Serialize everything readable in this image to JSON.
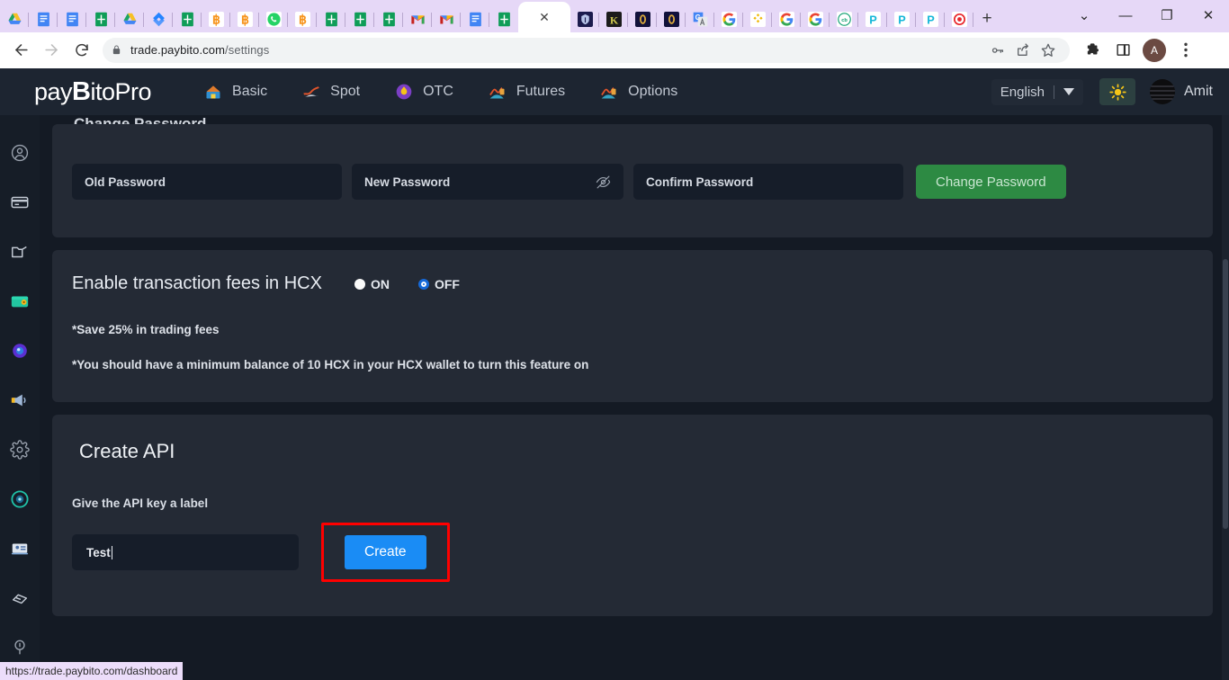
{
  "browser": {
    "tabs": [
      {
        "icon": "google-drive-icon",
        "type": "drive",
        "active": false
      },
      {
        "icon": "google-docs-icon",
        "type": "docs",
        "active": false
      },
      {
        "icon": "google-docs-icon",
        "type": "docs",
        "active": false
      },
      {
        "icon": "google-sheets-icon",
        "type": "sheets",
        "active": false
      },
      {
        "icon": "google-drive-icon",
        "type": "drive",
        "active": false
      },
      {
        "icon": "jira-icon",
        "type": "jira",
        "active": false
      },
      {
        "icon": "google-sheets-icon",
        "type": "sheets",
        "active": false
      },
      {
        "icon": "bitcoin-icon",
        "type": "btc",
        "active": false
      },
      {
        "icon": "bitcoin-icon",
        "type": "btc",
        "active": false
      },
      {
        "icon": "whatsapp-icon",
        "type": "whatsapp",
        "active": false
      },
      {
        "icon": "bitcoin-icon",
        "type": "btc",
        "active": false
      },
      {
        "icon": "google-sheets-icon",
        "type": "sheets",
        "active": false
      },
      {
        "icon": "google-sheets-icon",
        "type": "sheets",
        "active": false
      },
      {
        "icon": "google-sheets-icon",
        "type": "sheets",
        "active": false
      },
      {
        "icon": "gmail-icon",
        "type": "gmail",
        "active": false
      },
      {
        "icon": "gmail-icon",
        "type": "gmail",
        "active": false
      },
      {
        "icon": "google-docs-icon",
        "type": "docs",
        "active": false
      },
      {
        "icon": "google-sheets-icon",
        "type": "sheets",
        "active": false
      },
      {
        "icon": "close-icon",
        "type": "active",
        "active": true
      },
      {
        "icon": "paybito-icon",
        "type": "paybito",
        "active": false
      },
      {
        "icon": "kraken-icon",
        "type": "kraken",
        "active": false
      },
      {
        "icon": "coin-icon",
        "type": "coin",
        "active": false
      },
      {
        "icon": "coin-icon",
        "type": "coin",
        "active": false
      },
      {
        "icon": "google-translate-icon",
        "type": "translate",
        "active": false
      },
      {
        "icon": "google-icon",
        "type": "google",
        "active": false
      },
      {
        "icon": "binance-icon",
        "type": "binance",
        "active": false
      },
      {
        "icon": "google-icon",
        "type": "google",
        "active": false
      },
      {
        "icon": "google-icon",
        "type": "google",
        "active": false
      },
      {
        "icon": "coinbase-icon",
        "type": "coinbase",
        "active": false
      },
      {
        "icon": "paybito-p-icon",
        "type": "pbp",
        "active": false
      },
      {
        "icon": "paybito-p-icon",
        "type": "pbp",
        "active": false
      },
      {
        "icon": "paybito-p-icon",
        "type": "pbp",
        "active": false
      },
      {
        "icon": "record-icon",
        "type": "record",
        "active": false
      }
    ],
    "new_tab_label": "+",
    "tab_close_label": "✕",
    "window_controls": {
      "tab_search": "⌄",
      "minimize": "—",
      "maximize": "❐",
      "close": "✕"
    },
    "toolbar": {
      "back": "back-arrow",
      "forward": "forward-arrow",
      "reload": "reload-icon",
      "lock": "lock-icon",
      "url_domain": "trade.paybito.com",
      "url_path": "/settings",
      "password_key": "key-icon",
      "share": "share-icon",
      "bookmark": "star-icon",
      "extensions": "puzzle-icon",
      "sidepanel": "side-panel-icon",
      "profile_initial": "A",
      "menu": "three-dot-menu-icon"
    }
  },
  "site_header": {
    "logo_pre": "pay",
    "logo_b": "B",
    "logo_post": "itoPro",
    "nav": [
      {
        "label": "Basic",
        "icon": "basic-chart-icon"
      },
      {
        "label": "Spot",
        "icon": "spot-chart-icon"
      },
      {
        "label": "OTC",
        "icon": "otc-icon"
      },
      {
        "label": "Futures",
        "icon": "futures-chart-icon"
      },
      {
        "label": "Options",
        "icon": "options-chart-icon"
      }
    ],
    "language": "English",
    "language_caret": "▼",
    "theme_toggle": "sun-icon",
    "user_name": "Amit"
  },
  "sidebar": {
    "items": [
      {
        "name": "profile-icon"
      },
      {
        "name": "card-icon"
      },
      {
        "name": "folder-icon"
      },
      {
        "name": "wallet-icon"
      },
      {
        "name": "token-icon"
      },
      {
        "name": "announcement-icon"
      },
      {
        "name": "settings-gear-icon"
      },
      {
        "name": "support-icon"
      },
      {
        "name": "id-card-icon"
      },
      {
        "name": "tag-icon"
      },
      {
        "name": "info-icon"
      }
    ]
  },
  "content": {
    "cut_heading": "Change Password",
    "password_panel": {
      "old_password_placeholder": "Old Password",
      "new_password_placeholder": "New Password",
      "confirm_password_placeholder": "Confirm Password",
      "toggle_visibility_icon": "eye-off-icon",
      "change_password_label": "Change Password"
    },
    "hcx_panel": {
      "title": "Enable transaction fees in HCX",
      "options": [
        {
          "label": "ON",
          "selected": false
        },
        {
          "label": "OFF",
          "selected": true
        }
      ],
      "note_1": "*Save 25% in trading fees",
      "note_2": "*You should have a minimum balance of 10 HCX in your HCX wallet to turn this feature on"
    },
    "api_panel": {
      "title": "Create API",
      "label_prompt": "Give the API key a label",
      "input_value": "Test",
      "input_placeholder": "",
      "create_label": "Create",
      "highlight_color": "#ff0000"
    }
  },
  "status_bar": {
    "text": "https://trade.paybito.com/dashboard"
  },
  "colors": {
    "page_bg": "#141a24",
    "panel_bg": "#242a35",
    "field_bg": "#161d29",
    "header_bg": "#1d2531",
    "sidebar_bg": "#161d27",
    "green_button": "#2d8a43",
    "blue_button": "#1a8cf5",
    "radio_selected": "#1669d8",
    "tabstrip_bg": "#e6d8f7"
  }
}
